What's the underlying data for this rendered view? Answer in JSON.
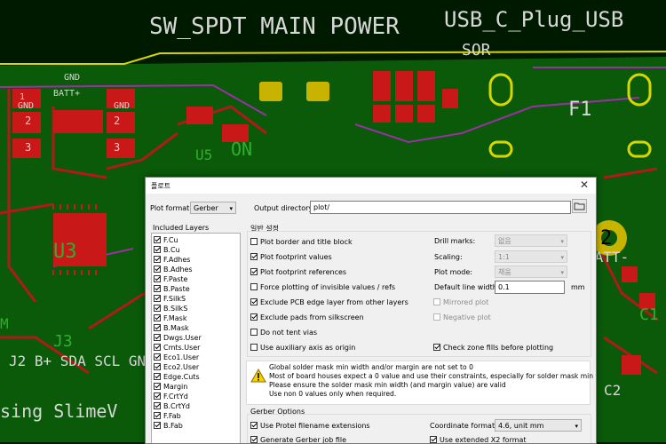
{
  "pcb": {
    "labels": [
      "SW_SPDT MAIN POWER",
      "USB_C_Plug_USB",
      "GND",
      "BATT+",
      "1\nGND",
      "2",
      "3",
      "GND",
      "ON",
      "DBT",
      "SOR",
      "F1",
      "U5",
      "R7",
      "C1",
      "U3",
      "U4",
      "J3",
      "J2",
      "B+ SDA SCL GN",
      "sing SlimeV",
      "C2",
      "BATT-",
      "2",
      "0"
    ],
    "colors": {
      "board": "#0a5a0a",
      "dark": "#001b00",
      "pad": "#c81818",
      "silk": "#d7d7d7",
      "edge": "#d6d600",
      "front": "#b01a1a"
    }
  },
  "dialog": {
    "title": "플로트",
    "close_glyph": "✕",
    "plot_format_label": "Plot format:",
    "plot_format_value": "Gerber",
    "output_dir_label": "Output directory:",
    "output_dir_value": "plot/",
    "included_layers_label": "Included Layers",
    "layers": [
      {
        "name": "F.Cu",
        "checked": true
      },
      {
        "name": "B.Cu",
        "checked": true
      },
      {
        "name": "F.Adhes",
        "checked": true
      },
      {
        "name": "B.Adhes",
        "checked": true
      },
      {
        "name": "F.Paste",
        "checked": true
      },
      {
        "name": "B.Paste",
        "checked": true
      },
      {
        "name": "F.SilkS",
        "checked": true
      },
      {
        "name": "B.SilkS",
        "checked": true
      },
      {
        "name": "F.Mask",
        "checked": true
      },
      {
        "name": "B.Mask",
        "checked": true
      },
      {
        "name": "Dwgs.User",
        "checked": true
      },
      {
        "name": "Cmts.User",
        "checked": true
      },
      {
        "name": "Eco1.User",
        "checked": true
      },
      {
        "name": "Eco2.User",
        "checked": true
      },
      {
        "name": "Edge.Cuts",
        "checked": true
      },
      {
        "name": "Margin",
        "checked": true
      },
      {
        "name": "F.CrtYd",
        "checked": true
      },
      {
        "name": "B.CrtYd",
        "checked": true
      },
      {
        "name": "F.Fab",
        "checked": true
      },
      {
        "name": "B.Fab",
        "checked": true
      }
    ],
    "general_title": "일반 설정",
    "general_options": [
      {
        "label": "Plot border and title block",
        "checked": false
      },
      {
        "label": "Plot footprint values",
        "checked": true
      },
      {
        "label": "Plot footprint references",
        "checked": true
      },
      {
        "label": "Force plotting of invisible values / refs",
        "checked": false
      },
      {
        "label": "Exclude PCB edge layer from other layers",
        "checked": true
      },
      {
        "label": "Exclude pads from silkscreen",
        "checked": true
      },
      {
        "label": "Do not tent vias",
        "checked": false
      },
      {
        "label": "Use auxiliary axis as origin",
        "checked": false
      }
    ],
    "drill_marks_label": "Drill marks:",
    "drill_marks_value": "없음",
    "scaling_label": "Scaling:",
    "scaling_value": "1:1",
    "plot_mode_label": "Plot mode:",
    "plot_mode_value": "채움",
    "default_line_width_label": "Default line width:",
    "default_line_width_value": "0.1",
    "unit": "mm",
    "mirrored_plot": {
      "label": "Mirrored plot",
      "checked": false
    },
    "negative_plot": {
      "label": "Negative plot",
      "checked": false
    },
    "check_zone": {
      "label": "Check zone fills before plotting",
      "checked": true
    },
    "warning_lines": [
      "Global solder mask min width and/or margin are not set to 0",
      "Most of board houses expect a 0 value and use their constraints, especially for solder mask min width.",
      "Please ensure the  solder mask min width (and margin value) are valid",
      "Use non 0 values only when required."
    ],
    "gerber_options_title": "Gerber Options",
    "use_protel": {
      "label": "Use Protel filename extensions",
      "checked": true
    },
    "generate_job": {
      "label": "Generate Gerber job file",
      "checked": true
    },
    "coordinate_format_label": "Coordinate format:",
    "coordinate_format_value": "4.6, unit mm",
    "use_x2": {
      "label": "Use extended X2 format",
      "checked": true
    }
  }
}
